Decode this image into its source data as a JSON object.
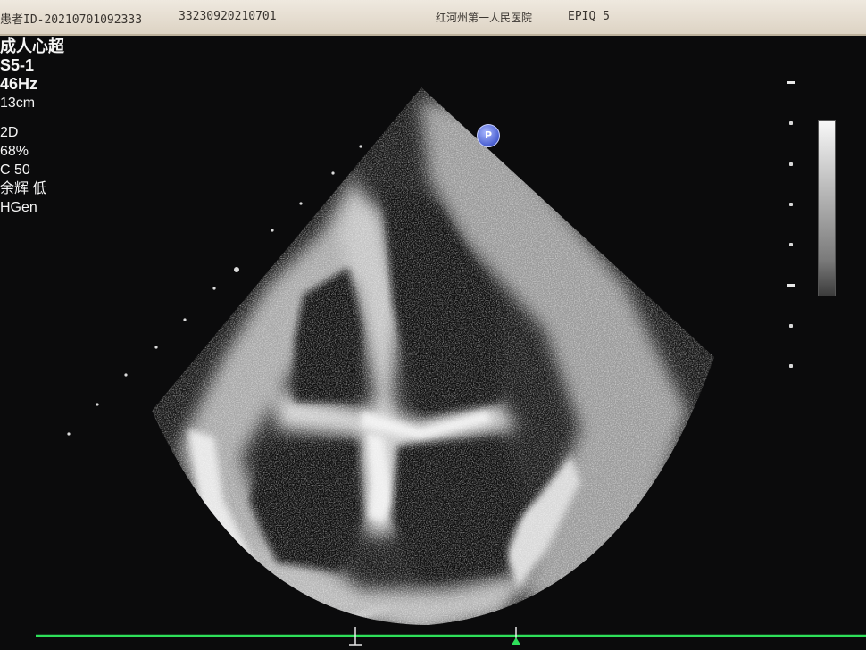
{
  "topbar": {
    "exam_id": "患者ID-20210701092333",
    "accession": "33230920210701",
    "hospital": "红河州第一人民医院",
    "system": "EPIQ 5"
  },
  "params": {
    "preset": "成人心超",
    "probe": "S5-1",
    "frequency": "46Hz",
    "depth": "13cm",
    "mode": "2D",
    "gain": "68%",
    "compression": "C 50",
    "persistence": "余辉 低",
    "resolution": "HGen"
  },
  "marker": {
    "label": "P",
    "color": "#4a5fd1"
  },
  "colors": {
    "background": "#0b0b0c",
    "topbar": "#e6dfd3",
    "ecg_trace": "#2ee05a"
  }
}
